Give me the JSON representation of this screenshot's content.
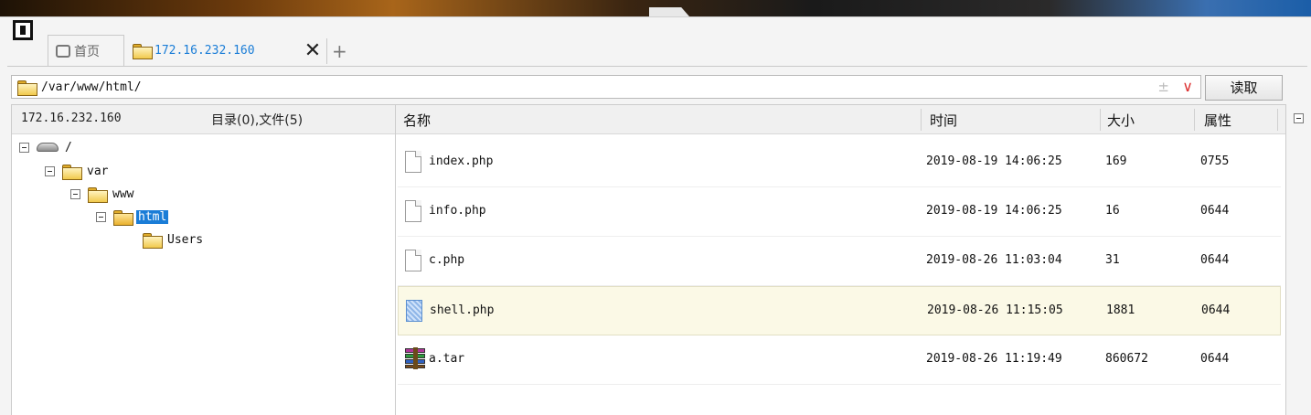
{
  "tabs": {
    "home_label": "首页",
    "active_label": "172.16.232.160",
    "close_symbol": "✕",
    "add_symbol": "+"
  },
  "address": {
    "path": "/var/www/html/",
    "read_button": "读取",
    "pm_symbol": "±",
    "dropdown_symbol": "∨"
  },
  "left_panel": {
    "ip": "172.16.232.160",
    "summary": "目录(0),文件(5)",
    "tree": [
      {
        "label": "/",
        "type": "drive"
      },
      {
        "label": "var",
        "type": "folder"
      },
      {
        "label": "www",
        "type": "folder"
      },
      {
        "label": "html",
        "type": "folder",
        "selected": true
      },
      {
        "label": "Users",
        "type": "folder"
      }
    ]
  },
  "file_list": {
    "columns": [
      "名称",
      "时间",
      "大小",
      "属性"
    ],
    "rows": [
      {
        "name": "index.php",
        "time": "2019-08-19 14:06:25",
        "size": "169",
        "attr": "0755",
        "icon": "file-icon"
      },
      {
        "name": "info.php",
        "time": "2019-08-19 14:06:25",
        "size": "16",
        "attr": "0644",
        "icon": "file-icon"
      },
      {
        "name": "c.php",
        "time": "2019-08-26 11:03:04",
        "size": "31",
        "attr": "0644",
        "icon": "file-icon"
      },
      {
        "name": "shell.php",
        "time": "2019-08-26 11:15:05",
        "size": "1881",
        "attr": "0644",
        "icon": "php-file-icon",
        "highlighted": true
      },
      {
        "name": "a.tar",
        "time": "2019-08-26 11:19:49",
        "size": "860672",
        "attr": "0644",
        "icon": "archive-icon"
      }
    ]
  },
  "colors": {
    "accent": "#1a7dd7",
    "highlight_row": "#fbf9e6"
  }
}
